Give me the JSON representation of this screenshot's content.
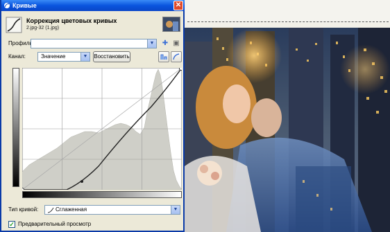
{
  "window": {
    "title": "Кривые",
    "close_glyph": "✕"
  },
  "header": {
    "title": "Коррекция цветовых кривых",
    "subtitle": "2.jpg-32 (1.jpg)"
  },
  "profile": {
    "label": "Профиль:",
    "value": ""
  },
  "channel": {
    "label": "Канал:",
    "value": "Значение",
    "reset_button": "Восстановить"
  },
  "curve_type": {
    "label": "Тип кривой:",
    "value": "Сглаженная"
  },
  "preview": {
    "label": "Предварительный просмотр",
    "checked": true
  },
  "colors": {
    "title_bar": "#0a55de",
    "dialog_bg": "#ece9d8",
    "histogram": "#cfcfc8"
  },
  "icons": [
    "kpivye-window-icon",
    "curves-tool-icon",
    "add-icon",
    "menu-icon",
    "dropdown-arrow-icon",
    "linear-histogram-icon",
    "log-histogram-icon",
    "smooth-curve-icon"
  ]
}
